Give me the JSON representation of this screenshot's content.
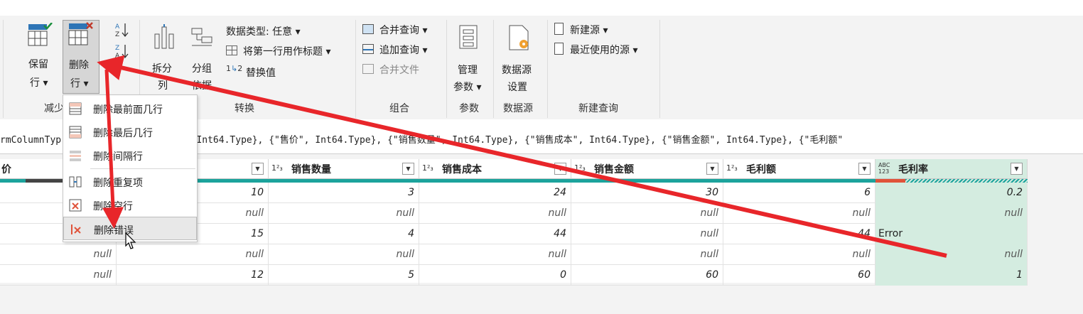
{
  "ribbon": {
    "keep_rows": {
      "line1": "保留",
      "line2": "行 ▾"
    },
    "remove_rows": {
      "line1": "删除",
      "line2": "行 ▾"
    },
    "sort_icon_asc": "sort-asc-icon",
    "split": {
      "line1": "拆分",
      "line2": "列"
    },
    "group_by": {
      "line1": "分组",
      "line2": "依据"
    },
    "data_type": "数据类型: 任意 ▾",
    "first_row_header": "将第一行用作标题 ▾",
    "replace_values": "替换值",
    "merge_queries": "合并查询 ▾",
    "append_queries": "追加查询 ▾",
    "combine_files": "合并文件",
    "manage_params": {
      "line1": "管理",
      "line2": "参数 ▾"
    },
    "datasource_settings": {
      "line1": "数据源",
      "line2": "设置"
    },
    "new_source": "新建源 ▾",
    "recent_sources": "最近使用的源 ▾",
    "groups": {
      "reduce": "减少",
      "transform": "转换",
      "combine": "组合",
      "parameters": "参数",
      "datasource": "数据源",
      "new_query": "新建查询"
    }
  },
  "formula": {
    "text": "rmColumnTyp                 \", type text}, {\"进价\", Int64.Type}, {\"售价\", Int64.Type}, {\"销售数量\", Int64.Type}, {\"销售成本\", Int64.Type}, {\"销售金额\", Int64.Type}, {\"毛利额\""
  },
  "menu": {
    "items": [
      {
        "label": "删除最前面几行",
        "icon": "remove-top-rows-icon"
      },
      {
        "label": "删除最后几行",
        "icon": "remove-bottom-rows-icon"
      },
      {
        "label": "删除间隔行",
        "icon": "remove-alternate-rows-icon"
      },
      {
        "label": "删除重复项",
        "icon": "remove-duplicates-icon"
      },
      {
        "label": "删除空行",
        "icon": "remove-blank-rows-icon"
      },
      {
        "label": "删除错误",
        "icon": "remove-errors-icon"
      }
    ]
  },
  "grid": {
    "columns": [
      {
        "name": "价",
        "type": ""
      },
      {
        "name": "",
        "type": ""
      },
      {
        "name": "销售数量",
        "type": "1²₃"
      },
      {
        "name": "销售成本",
        "type": "1²₃"
      },
      {
        "name": "销售金额",
        "type": "1²₃"
      },
      {
        "name": "毛利额",
        "type": "1²₃"
      },
      {
        "name": "毛利率",
        "type": "ABC 123"
      }
    ],
    "rows": [
      [
        "",
        "10",
        "3",
        "24",
        "30",
        "6",
        "0.2"
      ],
      [
        "",
        "null",
        "null",
        "null",
        "null",
        "null",
        "null"
      ],
      [
        "",
        "15",
        "4",
        "44",
        "null",
        "-44",
        "Error"
      ],
      [
        "null",
        "null",
        "null",
        "null",
        "null",
        "null",
        "null"
      ],
      [
        "null",
        "12",
        "5",
        "0",
        "60",
        "60",
        "1"
      ]
    ]
  },
  "colors": {
    "accent_arrow": "#e8262a",
    "quality_valid": "#1ba39c",
    "quality_error": "#e0533a",
    "selected_column": "#d4ece0"
  }
}
